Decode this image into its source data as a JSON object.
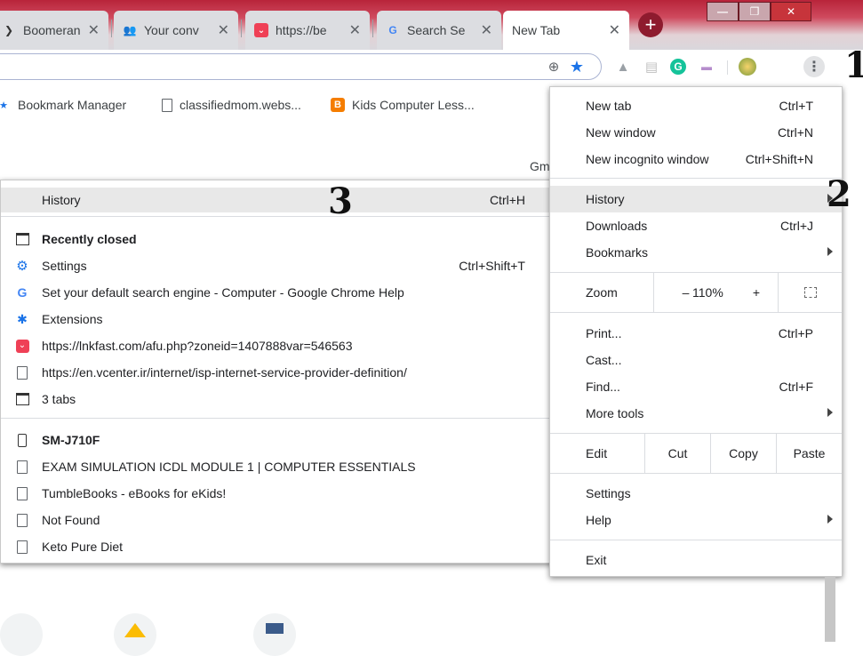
{
  "tabs": [
    {
      "label": "Boomeran",
      "favicon": "double-arrow-icon",
      "close": "✕"
    },
    {
      "label": "Your conv",
      "favicon": "people-icon",
      "close": "✕"
    },
    {
      "label": "https://be",
      "favicon": "pocket-icon",
      "close": "✕"
    },
    {
      "label": "Search Se",
      "favicon": "google-icon",
      "close": "✕"
    },
    {
      "label": "New Tab",
      "favicon": "",
      "close": "✕"
    }
  ],
  "new_tab_symbol": "+",
  "window_controls": {
    "minimize": "—",
    "maximize": "❐",
    "close": "✕"
  },
  "annotations": {
    "one": "1",
    "two": "2",
    "three": "3"
  },
  "bookmarks": [
    {
      "label": "Bookmark Manager",
      "icon": "star-icon"
    },
    {
      "label": "classifiedmom.webs...",
      "icon": "page-icon"
    },
    {
      "label": "Kids Computer Less...",
      "icon": "blogger-icon"
    }
  ],
  "partial_page_text": "Gm",
  "history_menu": {
    "header": {
      "label": "History",
      "shortcut": "Ctrl+H"
    },
    "recently_closed": {
      "label": "Recently closed"
    },
    "items": [
      {
        "label": "Settings",
        "shortcut": "Ctrl+Shift+T",
        "icon": "gear-icon"
      },
      {
        "label": "Set your default search engine - Computer - Google Chrome Help",
        "shortcut": "",
        "icon": "google-icon"
      },
      {
        "label": "Extensions",
        "shortcut": "",
        "icon": "puzzle-icon"
      },
      {
        "label": "https://lnkfast.com/afu.php?zoneid=1407888var=546563",
        "shortcut": "",
        "icon": "pocket-icon"
      },
      {
        "label": "https://en.vcenter.ir/internet/isp-internet-service-provider-definition/",
        "shortcut": "",
        "icon": "page-icon"
      },
      {
        "label": "3 tabs",
        "shortcut": "",
        "icon": "window-icon"
      }
    ],
    "device": {
      "label": "SM-J710F"
    },
    "device_items": [
      {
        "label": "EXAM SIMULATION ICDL MODULE 1 | COMPUTER ESSENTIALS"
      },
      {
        "label": "TumbleBooks - eBooks for eKids!"
      },
      {
        "label": "Not Found"
      },
      {
        "label": "Keto Pure Diet"
      }
    ]
  },
  "main_menu": {
    "new_tab": {
      "label": "New tab",
      "shortcut": "Ctrl+T"
    },
    "new_window": {
      "label": "New window",
      "shortcut": "Ctrl+N"
    },
    "new_incognito": {
      "label": "New incognito window",
      "shortcut": "Ctrl+Shift+N"
    },
    "history": {
      "label": "History"
    },
    "downloads": {
      "label": "Downloads",
      "shortcut": "Ctrl+J"
    },
    "bookmarks": {
      "label": "Bookmarks"
    },
    "zoom": {
      "label": "Zoom",
      "minus": "–",
      "value": "110%",
      "plus": "+"
    },
    "print": {
      "label": "Print...",
      "shortcut": "Ctrl+P"
    },
    "cast": {
      "label": "Cast..."
    },
    "find": {
      "label": "Find...",
      "shortcut": "Ctrl+F"
    },
    "more_tools": {
      "label": "More tools"
    },
    "edit": {
      "label": "Edit",
      "cut": "Cut",
      "copy": "Copy",
      "paste": "Paste"
    },
    "settings": {
      "label": "Settings"
    },
    "help": {
      "label": "Help"
    },
    "exit": {
      "label": "Exit"
    }
  },
  "colors": {
    "accent_blue": "#1a73e8",
    "tab_strip": "#b8243a",
    "google_blue": "#4285f4",
    "pocket_red": "#ef4056"
  }
}
